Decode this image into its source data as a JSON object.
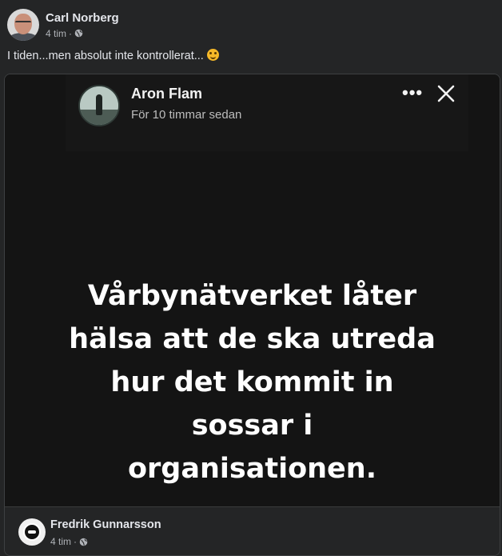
{
  "post": {
    "author": "Carl Norberg",
    "time": "4 tim",
    "separator": "·",
    "text": "I tiden...men absolut inte kontrollerat...",
    "emoji_icon": "winking-face-emoji",
    "privacy_icon": "globe-icon"
  },
  "shared_story": {
    "user_name": "Aron Flam",
    "time_ago": "För 10 timmar sedan",
    "more_label": "•••",
    "close_icon": "close-icon",
    "message_lines": [
      "Vårbynätverket låter",
      "hälsa att de ska utreda",
      "hur det kommit in",
      "sossar i",
      "organisationen."
    ]
  },
  "shared_footer": {
    "author": "Fredrik Gunnarsson",
    "time": "4 tim",
    "separator": "·",
    "privacy_icon": "globe-icon"
  },
  "colors": {
    "background": "#242526",
    "text_primary": "#e4e6eb",
    "text_secondary": "#b0b3b8",
    "story_background": "#141414"
  }
}
